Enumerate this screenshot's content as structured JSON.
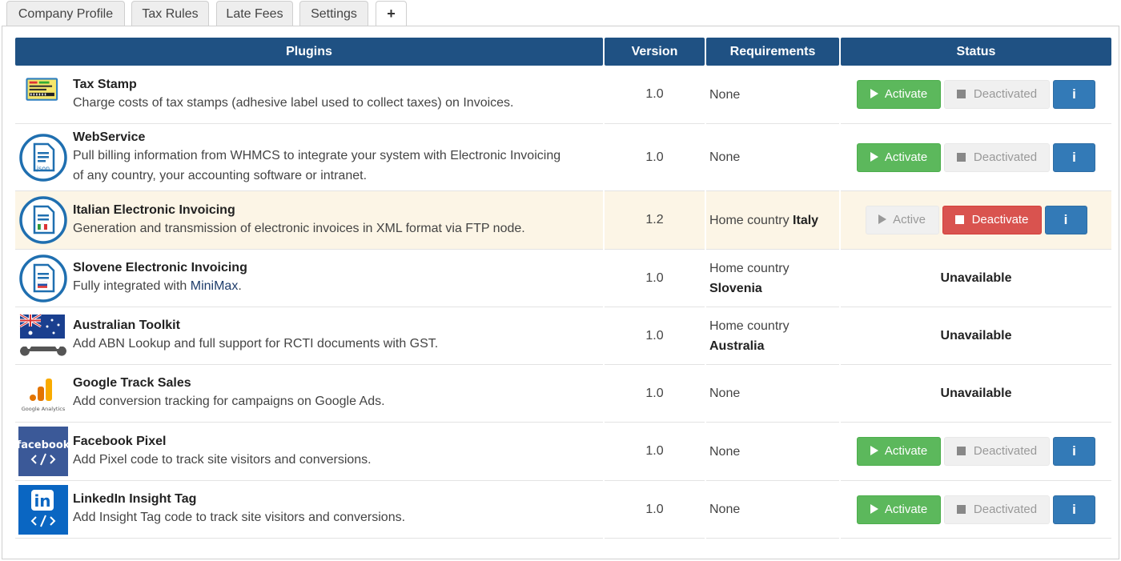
{
  "tabs": [
    {
      "label": "Company Profile"
    },
    {
      "label": "Tax Rules"
    },
    {
      "label": "Late Fees"
    },
    {
      "label": "Settings"
    },
    {
      "label": "+"
    }
  ],
  "table": {
    "headers": {
      "plugins": "Plugins",
      "version": "Version",
      "requirements": "Requirements",
      "status": "Status"
    },
    "buttons": {
      "activate": "Activate",
      "deactivated": "Deactivated",
      "active": "Active",
      "deactivate": "Deactivate",
      "info": "i"
    },
    "rows": [
      {
        "name": "Tax Stamp",
        "desc": "Charge costs of tax stamps (adhesive label used to collect taxes) on Invoices.",
        "version": "1.0",
        "req": "None",
        "status": "inactive",
        "logo": "tax-stamp-icon"
      },
      {
        "name": "WebService",
        "desc": "Pull billing information from WHMCS to integrate your system with Electronic Invoicing of any country, your accounting software or intranet.",
        "version": "1.0",
        "req": "None",
        "status": "inactive",
        "logo": "json-document-icon",
        "logo_text": "json"
      },
      {
        "name": "Italian Electronic Invoicing",
        "desc": "Generation and transmission of electronic invoices in XML format via FTP node.",
        "version": "1.2",
        "req_prefix": "Home country",
        "req_country": "Italy",
        "status": "active",
        "logo": "italian-invoice-icon"
      },
      {
        "name": "Slovene Electronic Invoicing",
        "desc_prefix": "Fully integrated with",
        "desc_link": "MiniMax",
        "desc_suffix": ".",
        "version": "1.0",
        "req_prefix": "Home country",
        "req_country": "Slovenia",
        "status": "unavailable",
        "status_text": "Unavailable",
        "logo": "slovene-invoice-icon"
      },
      {
        "name": "Australian Toolkit",
        "desc": "Add ABN Lookup and full support for RCTI documents with GST.",
        "version": "1.0",
        "req_prefix": "Home country",
        "req_country": "Australia",
        "status": "unavailable",
        "status_text": "Unavailable",
        "logo": "australia-wrench-icon"
      },
      {
        "name": "Google Track Sales",
        "desc": "Add conversion tracking for campaigns on Google Ads.",
        "version": "1.0",
        "req": "None",
        "status": "unavailable",
        "status_text": "Unavailable",
        "logo": "google-analytics-icon",
        "logo_text": "Google Analytics"
      },
      {
        "name": "Facebook Pixel",
        "desc": "Add Pixel code to track site visitors and conversions.",
        "version": "1.0",
        "req": "None",
        "status": "inactive",
        "logo": "facebook-code-icon",
        "logo_text": "facebook"
      },
      {
        "name": "LinkedIn Insight Tag",
        "desc": "Add Insight Tag code to track site visitors and conversions.",
        "version": "1.0",
        "req": "None",
        "status": "inactive",
        "logo": "linkedin-code-icon",
        "logo_text": "in"
      }
    ]
  },
  "colors": {
    "header_bg": "#1f5183",
    "activate": "#5cb85c",
    "deactivate": "#d9534f",
    "info": "#337ab7",
    "highlight_row": "#fcf5e6"
  }
}
